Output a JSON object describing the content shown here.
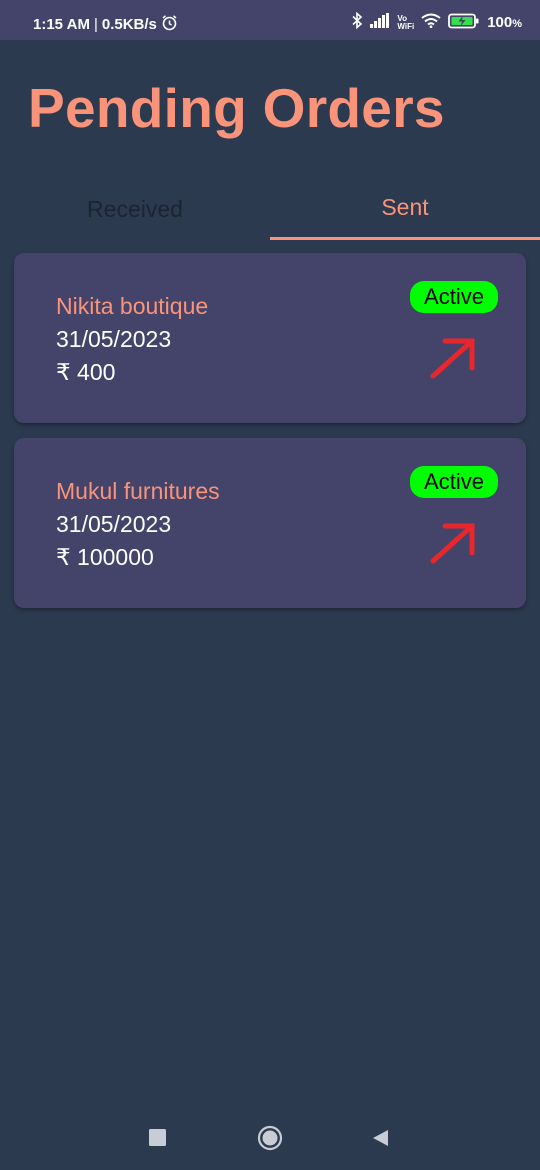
{
  "status_bar": {
    "time": "1:15 AM",
    "separator": "|",
    "speed": "0.5KB/s",
    "battery_percent": "100",
    "battery_unit": "%",
    "network_top": "Vo",
    "network_bottom": "WiFi"
  },
  "page": {
    "title": "Pending Orders"
  },
  "tabs": [
    {
      "label": "Received",
      "selected": false
    },
    {
      "label": "Sent",
      "selected": true
    }
  ],
  "orders": [
    {
      "name": "Nikita boutique",
      "date": "31/05/2023",
      "amount": "₹ 400",
      "status": "Active"
    },
    {
      "name": "Mukul furnitures",
      "date": "31/05/2023",
      "amount": "₹ 100000",
      "status": "Active"
    }
  ],
  "colors": {
    "accent": "#f9937a",
    "background": "#2c3a50",
    "card": "#44446a",
    "active_badge": "#00ff00",
    "arrow": "#e8262c"
  },
  "icons": {
    "order_action": "arrow-up-right-icon",
    "nav": [
      "square-icon",
      "circle-icon",
      "triangle-back-icon"
    ]
  }
}
